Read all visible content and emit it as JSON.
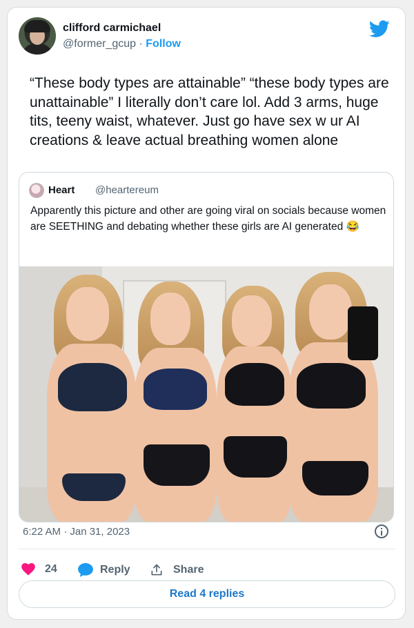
{
  "tweet": {
    "author_name": "clifford carmichael",
    "handle": "@former_gcup",
    "separator": " · ",
    "follow_label": "Follow",
    "text": "“These body types are attainable” “these body types are unattainable” I literally don’t care lol. Add 3 arms, huge tits, teeny waist, whatever. Just go have sex w ur AI creations & leave actual breathing women alone",
    "timestamp": "6:22 AM · Jan 31, 2023"
  },
  "quoted": {
    "author_name": "Heart",
    "handle": "@heartereum",
    "text": "Apparently this picture and other are going viral on socials because women are SEETHING and debating whether these girls are AI generated 😂"
  },
  "actions": {
    "like_count": "24",
    "reply_label": "Reply",
    "share_label": "Share",
    "read_replies_label": "Read 4 replies"
  },
  "icons": {
    "platform": "twitter-bird-icon",
    "like": "heart-icon",
    "reply": "speech-bubble-icon",
    "share": "share-icon",
    "info": "info-icon"
  },
  "colors": {
    "accent": "#1d9bf0",
    "like": "#f91880",
    "muted_text": "#536471"
  }
}
